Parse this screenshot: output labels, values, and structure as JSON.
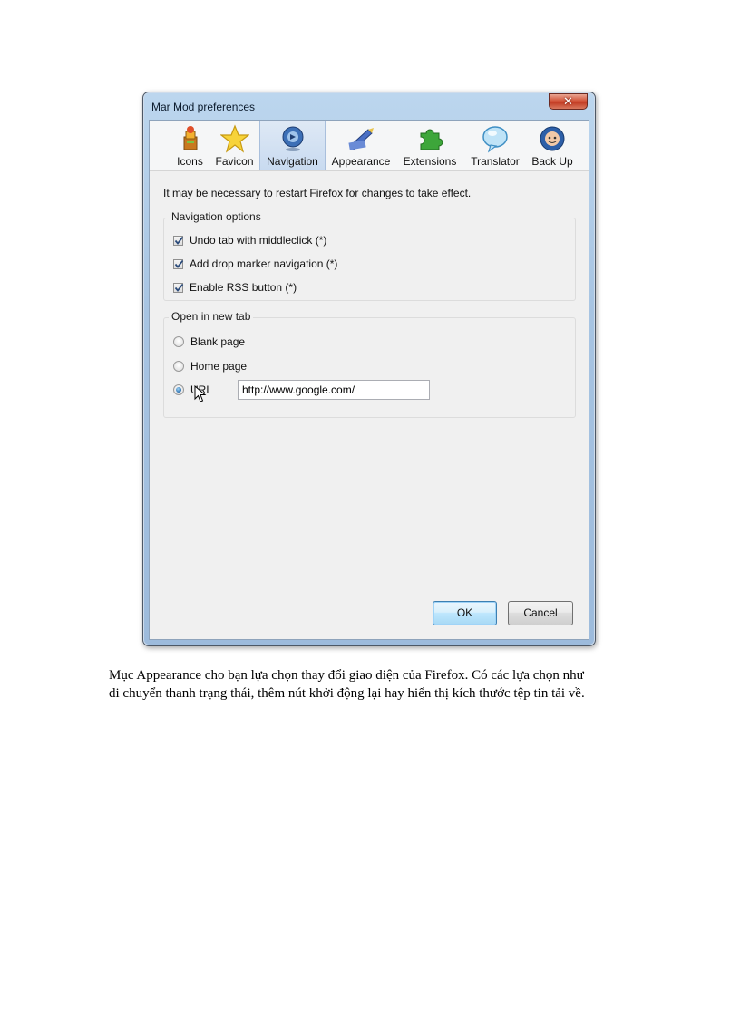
{
  "window": {
    "title": "Mar Mod preferences",
    "close_glyph": "✕"
  },
  "toolbar": {
    "items": [
      {
        "label": "Icons",
        "icon": "icons-icon",
        "selected": false
      },
      {
        "label": "Favicon",
        "icon": "star-icon",
        "selected": false
      },
      {
        "label": "Navigation",
        "icon": "navigation-icon",
        "selected": true
      },
      {
        "label": "Appearance",
        "icon": "appearance-icon",
        "selected": false
      },
      {
        "label": "Extensions",
        "icon": "puzzle-icon",
        "selected": false
      },
      {
        "label": "Translator",
        "icon": "speech-bubble-icon",
        "selected": false
      },
      {
        "label": "Back Up",
        "icon": "backup-icon",
        "selected": false
      }
    ]
  },
  "content": {
    "notice": "It may be necessary to restart Firefox for changes to take effect.",
    "navigation_options": {
      "title": "Navigation options",
      "checkboxes": [
        {
          "label": "Undo tab with middleclick (*)",
          "checked": true
        },
        {
          "label": "Add drop marker navigation (*)",
          "checked": true
        },
        {
          "label": "Enable RSS button (*)",
          "checked": true
        }
      ]
    },
    "open_in_new_tab": {
      "title": "Open in new tab",
      "radios": [
        {
          "label": "Blank page",
          "selected": false
        },
        {
          "label": "Home page",
          "selected": false
        },
        {
          "label": "URL",
          "selected": true
        }
      ],
      "url_value": "http://www.google.com/"
    }
  },
  "buttons": {
    "ok": "OK",
    "cancel": "Cancel"
  },
  "caption": {
    "line1": "Mục Appearance cho bạn lựa chọn thay đổi giao diện của Firefox. Có các lựa chọn như",
    "line2": "di chuyển thanh trạng thái, thêm nút khởi động lại hay hiển thị kích thước tệp tin tải về."
  }
}
